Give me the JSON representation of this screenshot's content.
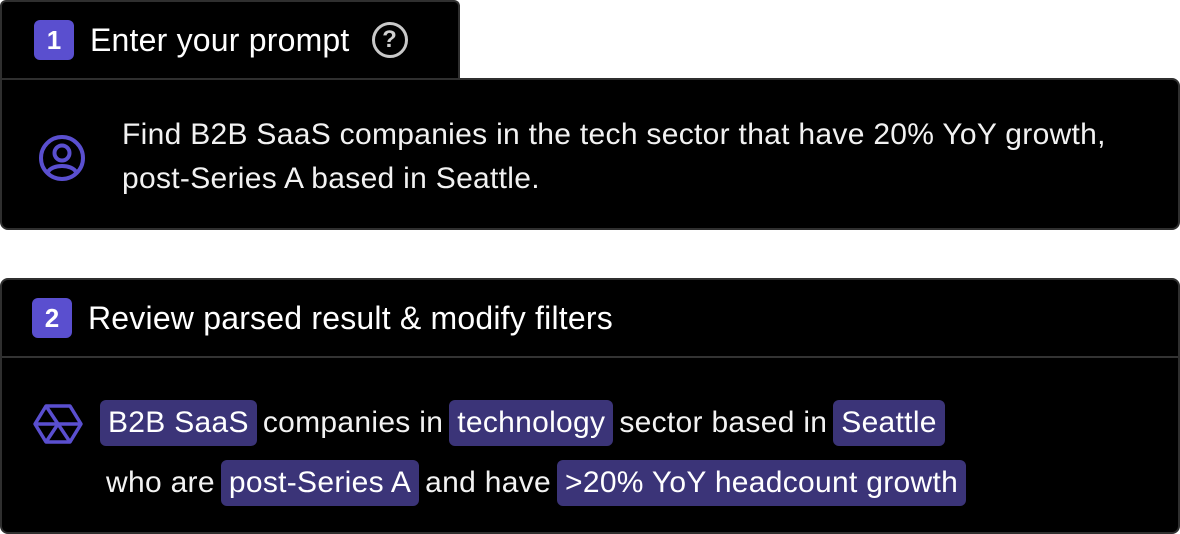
{
  "step1": {
    "number": "1",
    "title": "Enter your prompt",
    "help_symbol": "?",
    "prompt": "Find B2B SaaS companies in the tech sector that have 20% YoY growth, post-Series A based in Seattle.",
    "icon": "user-icon"
  },
  "step2": {
    "number": "2",
    "title": "Review parsed result & modify filters",
    "icon": "globe-icon",
    "line1": {
      "chip_segment": "B2B SaaS",
      "text1": "companies in",
      "chip_sector": "technology",
      "text2": "sector based in",
      "chip_location": "Seattle"
    },
    "line2": {
      "text1": "who are",
      "chip_stage": "post-Series A",
      "text2": "and have",
      "chip_growth": ">20% YoY headcount growth"
    }
  },
  "colors": {
    "accent": "#5a4fcf",
    "chip_bg": "#3b3478",
    "panel_bg": "#000000",
    "border": "#2f2f2f"
  }
}
